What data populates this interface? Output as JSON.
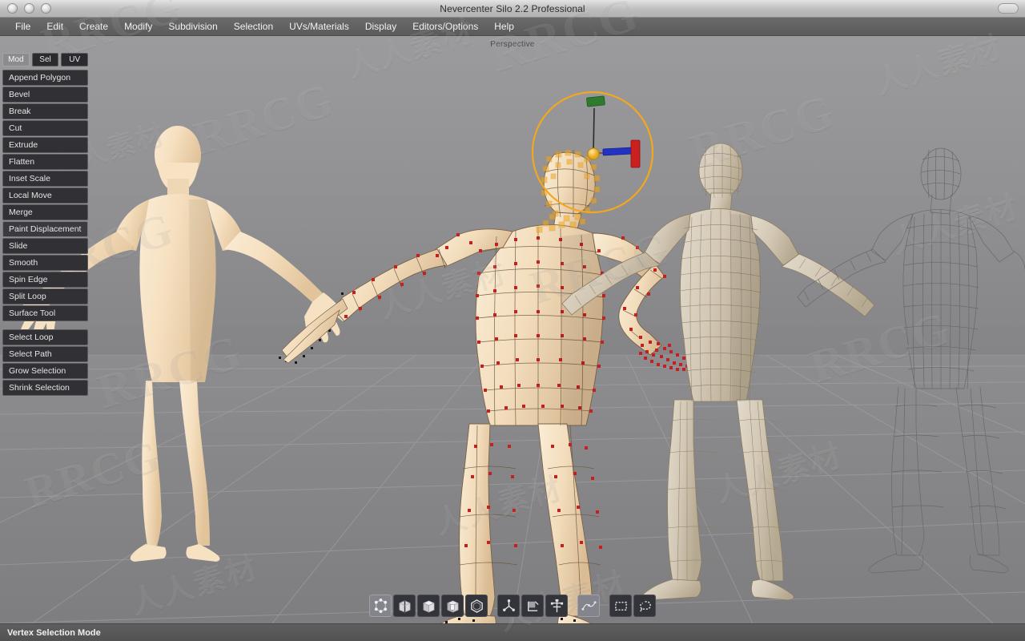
{
  "window": {
    "title": "Nevercenter Silo 2.2 Professional",
    "controls": [
      "close-button",
      "minimize-button",
      "zoom-button"
    ],
    "right_button": "toolbar-toggle-button"
  },
  "menubar": {
    "items": [
      {
        "label": "File",
        "name": "menu-file"
      },
      {
        "label": "Edit",
        "name": "menu-edit"
      },
      {
        "label": "Create",
        "name": "menu-create"
      },
      {
        "label": "Modify",
        "name": "menu-modify"
      },
      {
        "label": "Subdivision",
        "name": "menu-subdivision"
      },
      {
        "label": "Selection",
        "name": "menu-selection"
      },
      {
        "label": "UVs/Materials",
        "name": "menu-uvs-materials"
      },
      {
        "label": "Display",
        "name": "menu-display"
      },
      {
        "label": "Editors/Options",
        "name": "menu-editors-options"
      },
      {
        "label": "Help",
        "name": "menu-help"
      }
    ]
  },
  "toolpanel": {
    "tabs": [
      {
        "label": "Mod",
        "active": true
      },
      {
        "label": "Sel",
        "active": false
      },
      {
        "label": "UV",
        "active": false
      }
    ],
    "modeling_tools": [
      {
        "label": "Append Polygon",
        "highlighted": false
      },
      {
        "label": "Bevel",
        "highlighted": false
      },
      {
        "label": "Break",
        "highlighted": false
      },
      {
        "label": "Cut",
        "highlighted": false
      },
      {
        "label": "Extrude",
        "highlighted": false
      },
      {
        "label": "Flatten",
        "highlighted": false
      },
      {
        "label": "Inset Scale",
        "highlighted": false
      },
      {
        "label": "Local Move",
        "highlighted": false
      },
      {
        "label": "Merge",
        "highlighted": false
      },
      {
        "label": "Paint Displacement",
        "highlighted": true
      },
      {
        "label": "Slide",
        "highlighted": false
      },
      {
        "label": "Smooth",
        "highlighted": false
      },
      {
        "label": "Spin Edge",
        "highlighted": false
      },
      {
        "label": "Split Loop",
        "highlighted": false
      },
      {
        "label": "Surface Tool",
        "highlighted": false
      }
    ],
    "selection_tools": [
      {
        "label": "Select Loop"
      },
      {
        "label": "Select Path"
      },
      {
        "label": "Grow Selection"
      },
      {
        "label": "Shrink Selection"
      }
    ]
  },
  "viewport": {
    "label": "Perspective",
    "background_top": "#9a9a9c",
    "background_bottom": "#818184",
    "grid_color": "#a2a2a4",
    "models": [
      {
        "name": "model-smooth-shaded",
        "display": "smooth",
        "color": "#f4dcbc"
      },
      {
        "name": "model-selected-lowpoly",
        "display": "wireframe-vertices",
        "color": "#f0d7b4",
        "vertex_color": "#cc2020",
        "selected": true
      },
      {
        "name": "model-dense-wireframe",
        "display": "shaded-wireframe",
        "color": "#d8cdbb"
      },
      {
        "name": "model-wireframe-only",
        "display": "wireframe",
        "color": "#6f6f72"
      }
    ],
    "manipulator": {
      "name": "translate-manipulator",
      "ring_color": "#f2a81e",
      "x_axis_color": "#d42020",
      "y_axis_color": "#1f7a1f",
      "z_axis_color": "#2030c8",
      "center_color": "#f2c21e"
    }
  },
  "toolbar": {
    "buttons": [
      {
        "name": "vertex-mode-icon",
        "label": "Vertex Selection Mode",
        "active": true
      },
      {
        "name": "edge-mode-icon",
        "label": "Edge Selection Mode",
        "active": false
      },
      {
        "name": "face-mode-icon",
        "label": "Face Selection Mode",
        "active": false
      },
      {
        "name": "object-mode-icon",
        "label": "Object Selection Mode",
        "active": false
      },
      {
        "name": "subdivision-icon",
        "label": "Subdivision Preview",
        "active": false
      },
      {
        "name": "manipulator-move-icon",
        "label": "Move Manipulator",
        "active": false
      },
      {
        "name": "manipulator-rotate-icon",
        "label": "Rotate Manipulator",
        "active": false
      },
      {
        "name": "manipulator-scale-icon",
        "label": "Scale Manipulator",
        "active": false
      },
      {
        "name": "soft-selection-icon",
        "label": "Soft Selection Falloff",
        "active": true
      },
      {
        "name": "rectangle-select-icon",
        "label": "Rectangle Select",
        "active": false
      },
      {
        "name": "lasso-select-icon",
        "label": "Lasso Select",
        "active": false
      }
    ]
  },
  "statusbar": {
    "text": "Vertex Selection Mode"
  },
  "watermarks": {
    "brand": "RRCG",
    "chinese": "人人素材"
  }
}
